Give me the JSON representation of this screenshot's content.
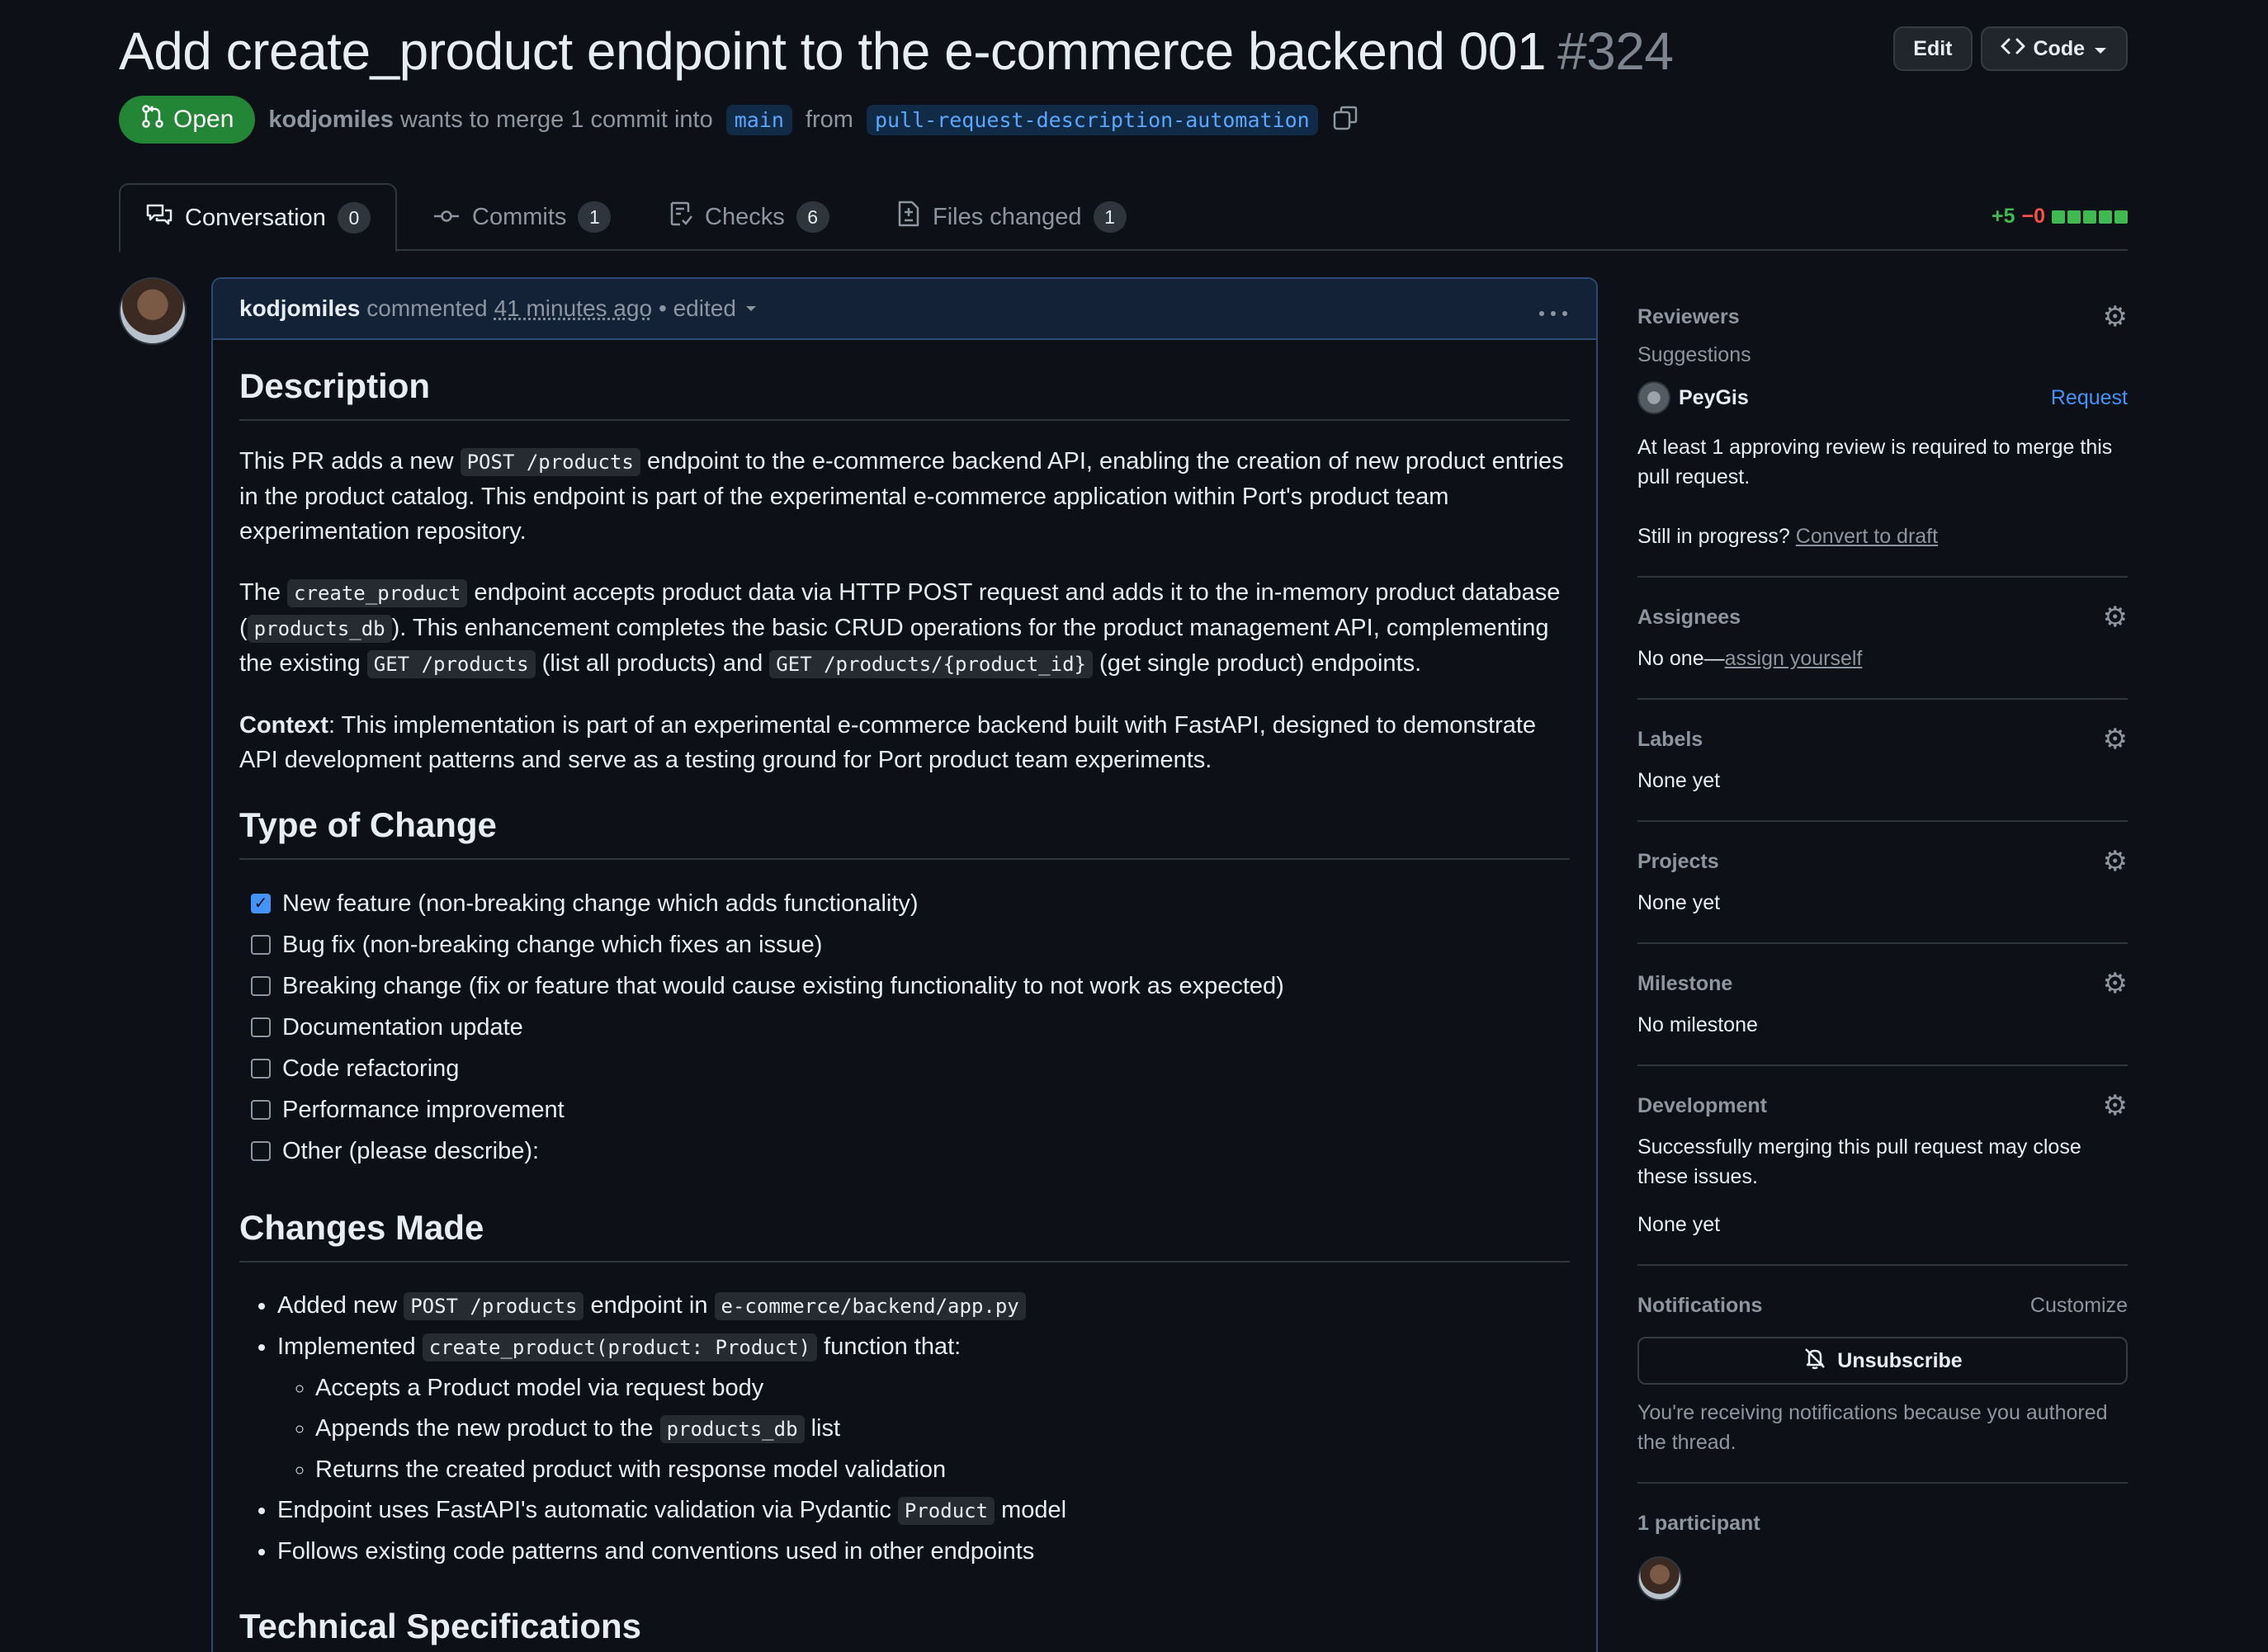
{
  "header": {
    "title": "Add create_product endpoint to the e-commerce backend 001",
    "number": "#324",
    "edit_label": "Edit",
    "code_label": "Code",
    "state": "Open",
    "author": "kodjomiles",
    "merge_text": "wants to merge 1 commit into",
    "base_branch": "main",
    "from_text": "from",
    "head_branch": "pull-request-description-automation"
  },
  "tabs": [
    {
      "label": "Conversation",
      "count": "0"
    },
    {
      "label": "Commits",
      "count": "1"
    },
    {
      "label": "Checks",
      "count": "6"
    },
    {
      "label": "Files changed",
      "count": "1"
    }
  ],
  "diffstat": {
    "added": "+5",
    "removed": "−0"
  },
  "comment": {
    "author": "kodjomiles",
    "verb": "commented",
    "time": "41 minutes ago",
    "edited": "• edited",
    "description_heading": "Description",
    "p1": {
      "a": "This PR adds a new",
      "code1": "POST /products",
      "b": "endpoint to the e-commerce backend API, enabling the creation of new product entries in the product catalog. This endpoint is part of the experimental e-commerce application within Port's product team experimentation repository."
    },
    "p2": {
      "a": "The",
      "code1": "create_product",
      "b": "endpoint accepts product data via HTTP POST request and adds it to the in-memory product database (",
      "code2": "products_db",
      "c": "). This enhancement completes the basic CRUD operations for the product management API, complementing the existing",
      "code3": "GET /products",
      "d": "(list all products) and",
      "code4": "GET /products/{product_id}",
      "e": "(get single product) endpoints."
    },
    "p3": {
      "bold": "Context",
      "text": ": This implementation is part of an experimental e-commerce backend built with FastAPI, designed to demonstrate API development patterns and serve as a testing ground for Port product team experiments."
    },
    "type_heading": "Type of Change",
    "tasks": [
      {
        "label": "New feature (non-breaking change which adds functionality)",
        "checked": true
      },
      {
        "label": "Bug fix (non-breaking change which fixes an issue)",
        "checked": false
      },
      {
        "label": "Breaking change (fix or feature that would cause existing functionality to not work as expected)",
        "checked": false
      },
      {
        "label": "Documentation update",
        "checked": false
      },
      {
        "label": "Code refactoring",
        "checked": false
      },
      {
        "label": "Performance improvement",
        "checked": false
      },
      {
        "label": "Other (please describe):",
        "checked": false
      }
    ],
    "changes_heading": "Changes Made",
    "changes": {
      "c1a": "Added new",
      "c1code": "POST /products",
      "c1b": "endpoint in",
      "c1code2": "e-commerce/backend/app.py",
      "c2a": "Implemented",
      "c2code": "create_product(product: Product)",
      "c2b": "function that:",
      "s1": "Accepts a Product model via request body",
      "s2a": "Appends the new product to the",
      "s2code": "products_db",
      "s2b": "list",
      "s3": "Returns the created product with response model validation",
      "c3a": "Endpoint uses FastAPI's automatic validation via Pydantic",
      "c3code": "Product",
      "c3b": "model",
      "c4": "Follows existing code patterns and conventions used in other endpoints"
    },
    "tech_heading": "Technical Specifications"
  },
  "sidebar": {
    "reviewers": {
      "heading": "Reviewers",
      "suggestions": "Suggestions",
      "reviewer": "PeyGis",
      "request": "Request",
      "required_text": "At least 1 approving review is required to merge this pull request.",
      "in_progress": "Still in progress?",
      "convert": "Convert to draft"
    },
    "assignees": {
      "heading": "Assignees",
      "text": "No one—",
      "link": "assign yourself"
    },
    "labels": {
      "heading": "Labels",
      "text": "None yet"
    },
    "projects": {
      "heading": "Projects",
      "text": "None yet"
    },
    "milestone": {
      "heading": "Milestone",
      "text": "No milestone"
    },
    "development": {
      "heading": "Development",
      "text": "Successfully merging this pull request may close these issues.",
      "none": "None yet"
    },
    "notifications": {
      "heading": "Notifications",
      "customize": "Customize",
      "button": "Unsubscribe",
      "reason": "You're receiving notifications because you authored the thread."
    },
    "participants": {
      "heading": "1 participant"
    }
  }
}
